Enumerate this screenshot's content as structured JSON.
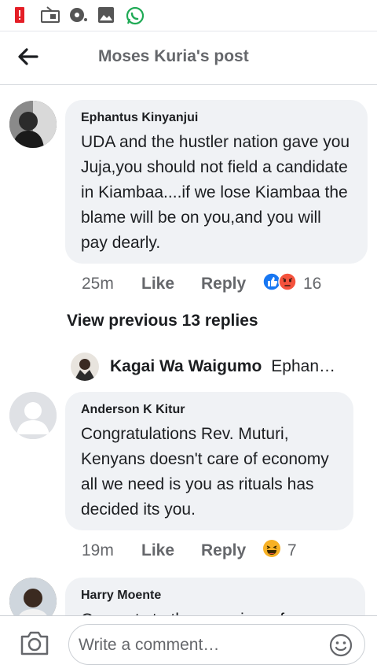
{
  "header": {
    "title": "Moses Kuria's post"
  },
  "comments": [
    {
      "author": "Ephantus Kinyanjui",
      "text": "UDA and the hustler nation gave you Juja,you should not field a candidate in Kiambaa....if we lose Kiambaa the blame will be on you,and you will pay dearly.",
      "time": "25m",
      "like_label": "Like",
      "reply_label": "Reply",
      "reactions": [
        "like-icon",
        "angry-icon"
      ],
      "reaction_count": "16"
    },
    {
      "author": "Anderson K Kitur",
      "text": "Congratulations Rev. Muturi, Kenyans doesn't care of economy all we need is you as rituals has decided its you.",
      "time": "19m",
      "like_label": "Like",
      "reply_label": "Reply",
      "reactions": [
        "haha-icon"
      ],
      "reaction_count": "7"
    },
    {
      "author": "Harry Moente",
      "text": "Congrats to the organizers for"
    }
  ],
  "view_previous": "View previous 13 replies",
  "latest_reply": {
    "author": "Kagai Wa Waigumo",
    "preview": "Ephan…"
  },
  "composer": {
    "placeholder": "Write a comment…"
  },
  "colors": {
    "accent": "#1877f2",
    "bubble": "#f0f2f5",
    "muted": "#65676b",
    "angry": "#f5533d",
    "haha": "#f7b125"
  }
}
